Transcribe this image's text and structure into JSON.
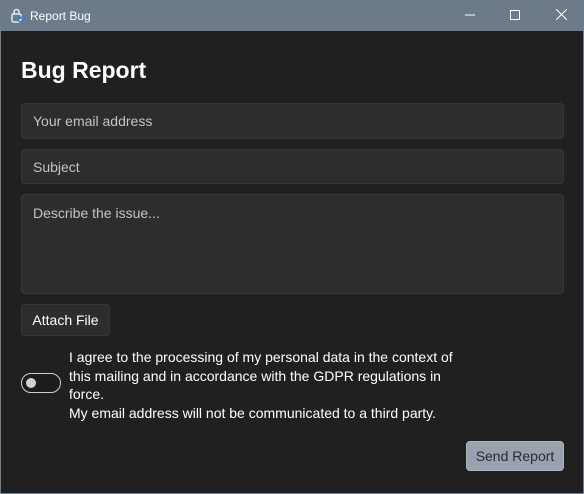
{
  "window": {
    "title": "Report Bug",
    "icon": "bug-report-app-icon",
    "controls": {
      "minimize": "minimize-icon",
      "maximize": "maximize-icon",
      "close": "close-icon"
    },
    "titlebar_color": "#6d7a8a"
  },
  "form": {
    "heading": "Bug Report",
    "email": {
      "value": "",
      "placeholder": "Your email address"
    },
    "subject": {
      "value": "",
      "placeholder": "Subject"
    },
    "issue": {
      "value": "",
      "placeholder": "Describe the issue..."
    },
    "attach_label": "Attach File",
    "consent": {
      "enabled": false,
      "lines": [
        "I agree to the processing of my personal data in the context of",
        "this mailing and in accordance with the GDPR regulations in",
        "force.",
        "My email address will not be communicated to a third party."
      ]
    },
    "send_label": "Send Report"
  },
  "colors": {
    "background": "#202020",
    "field_background": "#2d2d2d",
    "send_button": "#99a3b0"
  }
}
